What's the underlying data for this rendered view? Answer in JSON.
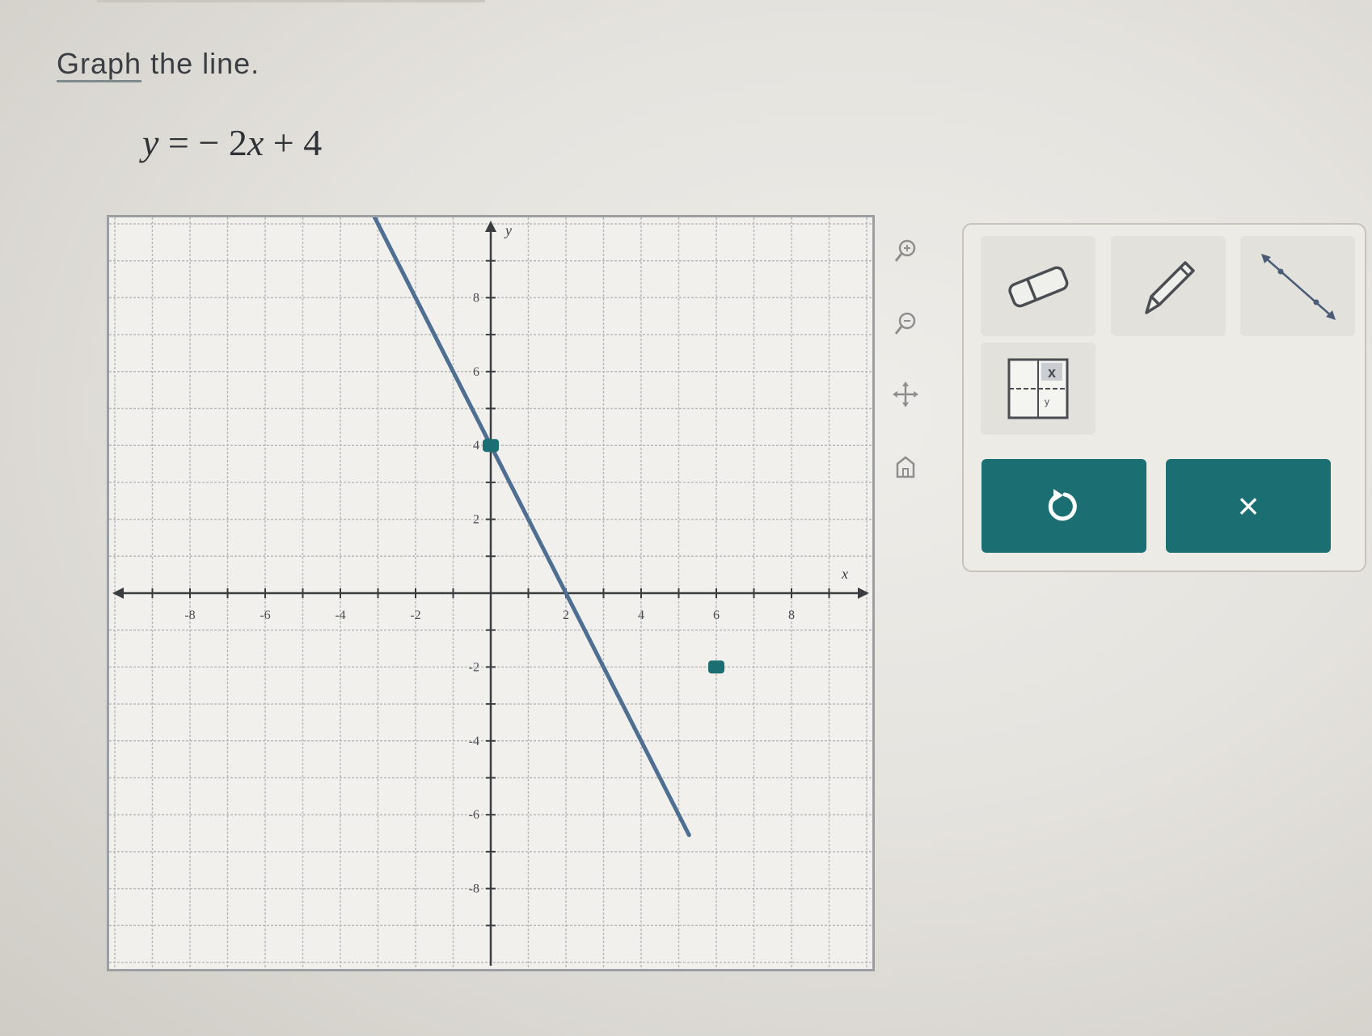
{
  "prompt": {
    "link_text": "Graph",
    "rest_text": " the line."
  },
  "equation": {
    "lhs": "y",
    "eq": " = ",
    "rest": "− 2",
    "var": "x",
    "tail": " + 4"
  },
  "graph": {
    "xlim": [
      -10,
      10
    ],
    "ylim": [
      -10,
      10
    ],
    "x_axis_label": "x",
    "y_axis_label": "y",
    "x_tick_labels": [
      {
        "v": -8,
        "t": "-8"
      },
      {
        "v": -6,
        "t": "-6"
      },
      {
        "v": -4,
        "t": "-4"
      },
      {
        "v": -2,
        "t": "-2"
      },
      {
        "v": 2,
        "t": "2"
      },
      {
        "v": 4,
        "t": "4"
      },
      {
        "v": 6,
        "t": "6"
      },
      {
        "v": 8,
        "t": "8"
      }
    ],
    "y_tick_labels": [
      {
        "v": 8,
        "t": "8"
      },
      {
        "v": 6,
        "t": "6"
      },
      {
        "v": 4,
        "t": "4"
      },
      {
        "v": 2,
        "t": "2"
      },
      {
        "v": -2,
        "t": "-2"
      },
      {
        "v": -4,
        "t": "-4"
      },
      {
        "v": -6,
        "t": "-6"
      },
      {
        "v": -8,
        "t": "-8"
      }
    ],
    "line": {
      "slope": -2,
      "intercept": 4,
      "color": "#4e6f92"
    },
    "points": [
      {
        "x": 0,
        "y": 4
      },
      {
        "x": 6,
        "y": -2
      }
    ],
    "point_color": "#1b6f73",
    "grid_color": "#b9bbbb",
    "axis_color": "#3a3d40"
  },
  "side_icons": [
    "zoom-in-icon",
    "zoom-out-icon",
    "move-icon",
    "home-icon"
  ],
  "tools": [
    "eraser-icon",
    "pencil-icon",
    "line-tool-icon",
    "table-tool-icon"
  ],
  "table_tool": {
    "col_header": "x",
    "row_label": "y"
  },
  "actions": {
    "undo": "↺",
    "reset": "×"
  },
  "accent_color": "#1b6f73"
}
